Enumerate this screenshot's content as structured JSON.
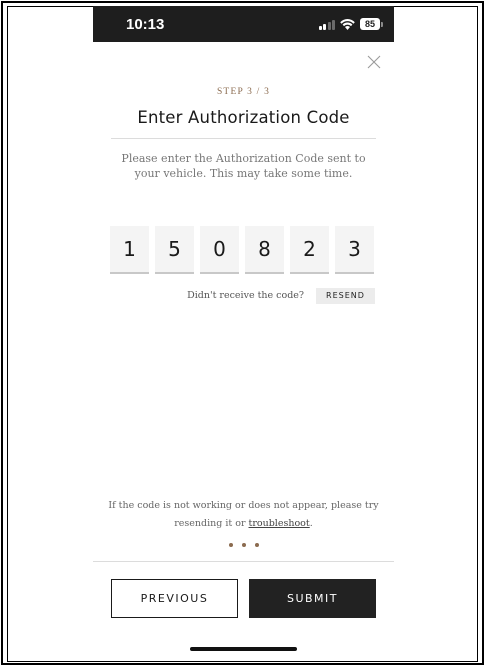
{
  "status_bar": {
    "time": "10:13",
    "battery": "85",
    "icons": [
      "signal-icon",
      "wifi-icon",
      "battery-icon"
    ]
  },
  "header": {
    "step": "STEP 3 / 3",
    "title": "Enter Authorization Code",
    "close_icon": "close-icon"
  },
  "main": {
    "instructions": "Please enter the Authorization Code sent to your vehicle. This may take some time.",
    "code_digits": [
      "1",
      "5",
      "0",
      "8",
      "2",
      "3"
    ],
    "resend_prompt": "Didn't receive the code?",
    "resend_label": "RESEND"
  },
  "footer": {
    "help_prefix": "If the code is not working or does not appear, please try resending it or ",
    "help_link": "troubleshoot",
    "help_suffix": ".",
    "progress_dots": 3,
    "previous_label": "PREVIOUS",
    "submit_label": "SUBMIT"
  },
  "colors": {
    "accent": "#8b6b4f",
    "primary_button": "#222222",
    "status_bar": "#1e1e1e"
  }
}
